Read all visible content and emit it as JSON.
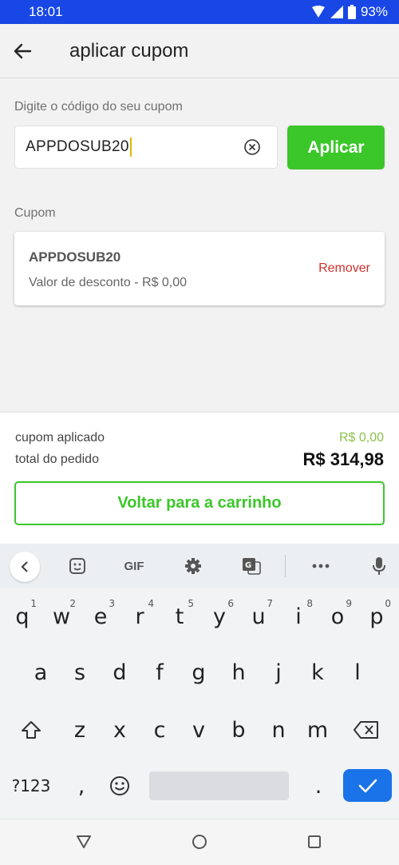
{
  "status": {
    "time": "18:01",
    "battery": "93%"
  },
  "header": {
    "title": "aplicar cupom"
  },
  "form": {
    "label": "Digite o código do seu cupom",
    "value": "APPDOSUB20",
    "apply_label": "Aplicar"
  },
  "coupon": {
    "section_label": "Cupom",
    "code": "APPDOSUB20",
    "discount_text": "Valor de desconto - R$ 0,00",
    "remove_label": "Remover"
  },
  "summary": {
    "coupon_label": "cupom aplicado",
    "coupon_value": "R$ 0,00",
    "total_label": "total do pedido",
    "total_value": "R$ 314,98",
    "back_label": "Voltar para a carrinho"
  },
  "keyboard": {
    "gif_label": "GIF",
    "row1": [
      "q",
      "w",
      "e",
      "r",
      "t",
      "y",
      "u",
      "i",
      "o",
      "p"
    ],
    "row1_hints": [
      "1",
      "2",
      "3",
      "4",
      "5",
      "6",
      "7",
      "8",
      "9",
      "0"
    ],
    "row2": [
      "a",
      "s",
      "d",
      "f",
      "g",
      "h",
      "j",
      "k",
      "l"
    ],
    "row3": [
      "z",
      "x",
      "c",
      "v",
      "b",
      "n",
      "m"
    ],
    "symbols_label": "?123",
    "comma": ",",
    "period": "."
  },
  "colors": {
    "accent": "#3bc72a",
    "status_bar": "#1947e6",
    "remove": "#d0312d",
    "enter": "#1a73e8"
  }
}
